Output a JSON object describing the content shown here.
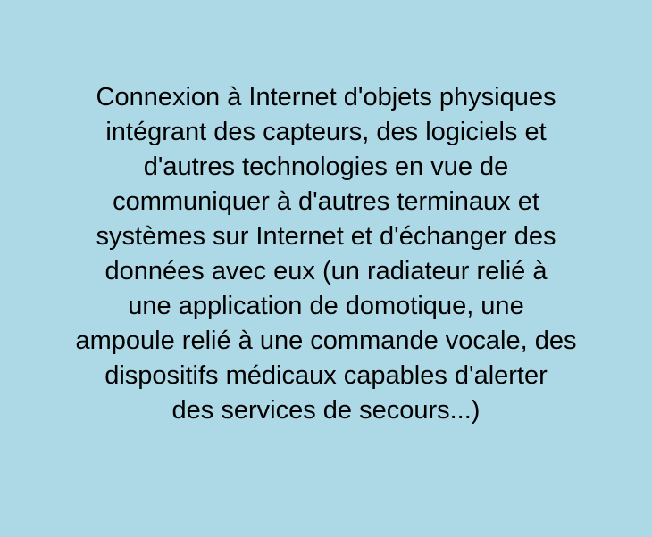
{
  "card": {
    "background_color": "#add8e6",
    "text_color": "#000000",
    "lines": [
      "Connexion à Internet d'objets physiques",
      "intégrant des capteurs, des logiciels et",
      "d'autres technologies en vue de",
      "communiquer à d'autres terminaux et",
      "systèmes sur Internet et d'échanger des",
      "données avec eux (un radiateur relié à",
      "une application de domotique, une",
      "ampoule relié à une commande vocale, des",
      "dispositifs médicaux capables d'alerter",
      "des services de secours...)"
    ]
  }
}
